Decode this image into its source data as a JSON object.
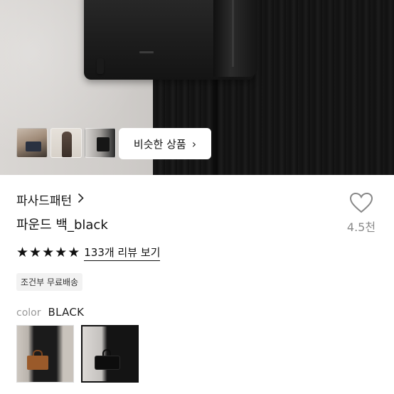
{
  "gallery": {
    "thumbnails": [
      "thumbnail-1",
      "thumbnail-2",
      "thumbnail-3"
    ],
    "similar_button_label": "비슷한 상품",
    "similar_button_icon": "chevron-right-icon"
  },
  "product": {
    "shop_name": "파사드패턴",
    "shop_icon": "chevron-right-icon",
    "name": "파운드 백_black",
    "like_icon": "heart-outline-icon",
    "like_count": "4.5천",
    "rating": 5,
    "star_glyph": "★",
    "review_link": "133개 리뷰 보기",
    "shipping_badge": "조건부 무료배송",
    "color_label": "color",
    "color_value": "BLACK",
    "color_options": [
      {
        "name": "brown-variant",
        "selected": false
      },
      {
        "name": "black-variant",
        "selected": true
      }
    ]
  },
  "colors": {
    "text_primary": "#111111",
    "text_muted": "#8a8a8a",
    "badge_bg": "#f2f2f2",
    "selected_border": "#111111"
  }
}
